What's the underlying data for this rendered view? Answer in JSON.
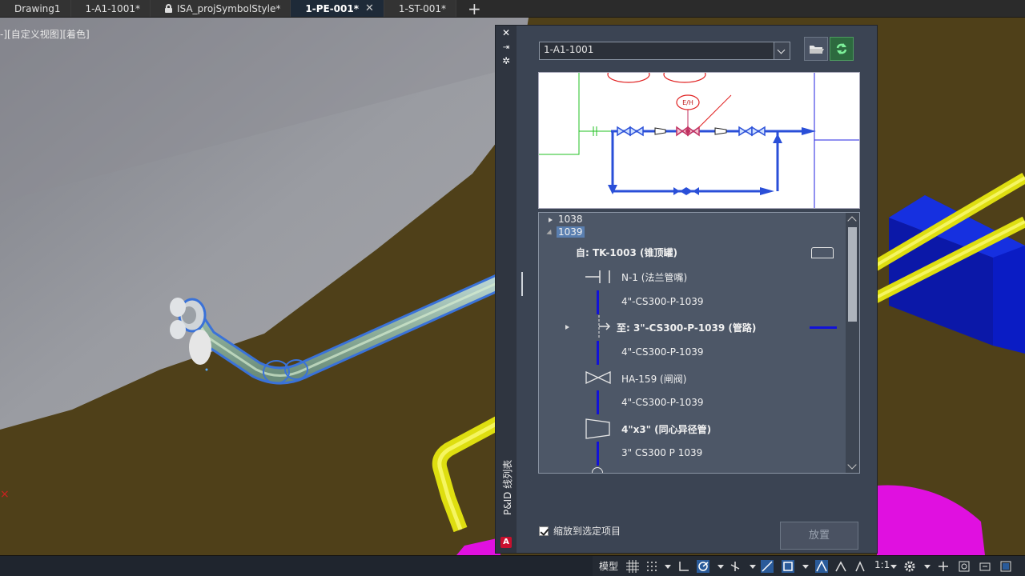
{
  "tabs": [
    {
      "label": "Drawing1",
      "active": false
    },
    {
      "label": "1-A1-1001*",
      "active": false
    },
    {
      "label": "ISA_projSymbolStyle*",
      "active": false,
      "locked": true
    },
    {
      "label": "1-PE-001*",
      "active": true,
      "closable": true
    },
    {
      "label": "1-ST-001*",
      "active": false
    }
  ],
  "viewport": {
    "label": "-][自定义视图][着色]"
  },
  "palette": {
    "title": "P&ID 线列表",
    "drawing_value": "1-A1-1001",
    "preview_labels": {
      "instrument": "E/H"
    },
    "tree": {
      "items": [
        {
          "text": "1038"
        },
        {
          "text": "1039"
        },
        {
          "text": "自: TK-1003 (锥顶罐)"
        },
        {
          "text": "N-1 (法兰管嘴)"
        },
        {
          "text": "4\"-CS300-P-1039"
        },
        {
          "text": "至: 3\"-CS300-P-1039 (管路)"
        },
        {
          "text": "4\"-CS300-P-1039"
        },
        {
          "text": "HA-159 (闸阀)"
        },
        {
          "text": "4\"-CS300-P-1039"
        },
        {
          "text": "4\"x3\" (同心异径管)"
        },
        {
          "text": "3\" CS300 P 1039"
        }
      ]
    },
    "zoom_checkbox_label": "缩放到选定项目",
    "zoom_checked": true,
    "place_button": "放置"
  },
  "statusbar": {
    "model_label": "模型",
    "scale_label": "1:1"
  },
  "colors": {
    "pipe_blue": "#1212d8",
    "panel_bg": "#3b4453",
    "accent_red": "#c8102e"
  }
}
